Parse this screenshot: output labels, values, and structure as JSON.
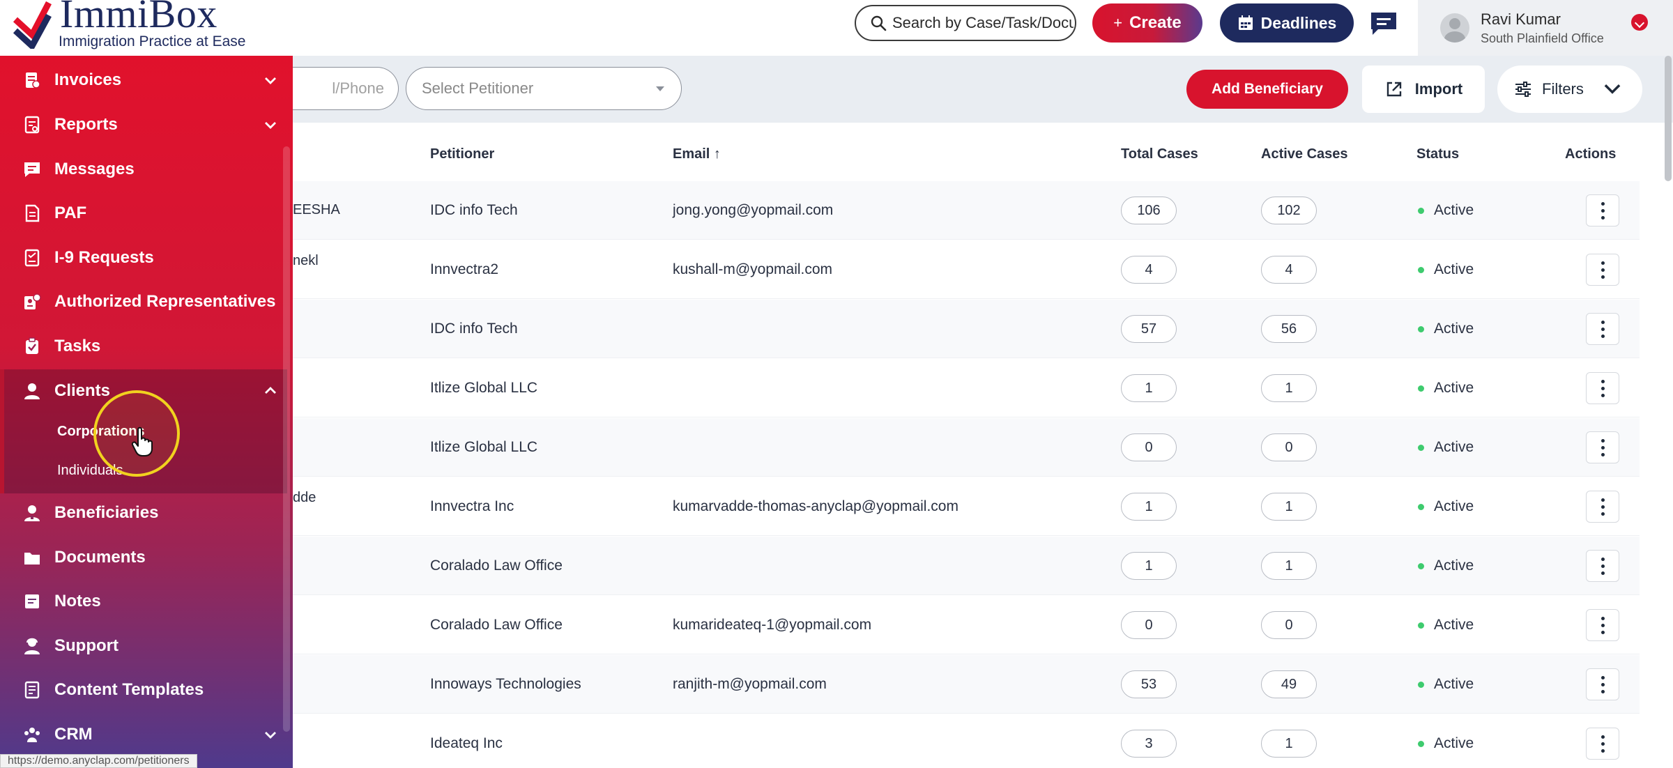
{
  "brand": {
    "name": "ImmiBox",
    "tagline": "Immigration Practice at Ease"
  },
  "header": {
    "search_placeholder": "Search by Case/Task/Docu",
    "create_label": "Create",
    "create_plus": "+",
    "deadlines_label": "Deadlines",
    "user": {
      "name": "Ravi Kumar",
      "office": "South Plainfield Office"
    }
  },
  "toolbar": {
    "search_placeholder": "l/Phone",
    "petitioner_select": "Select Petitioner",
    "add_beneficiary_label": "Add Beneficiary",
    "import_label": "Import",
    "filters_label": "Filters"
  },
  "sidebar": {
    "items": [
      {
        "label": "Invoices",
        "icon": "invoice-icon",
        "has_chevron": true
      },
      {
        "label": "Reports",
        "icon": "report-icon",
        "has_chevron": true
      },
      {
        "label": "Messages",
        "icon": "message-icon"
      },
      {
        "label": "PAF",
        "icon": "document-icon"
      },
      {
        "label": "I-9 Requests",
        "icon": "request-icon"
      },
      {
        "label": "Authorized Representatives",
        "icon": "representative-icon"
      },
      {
        "label": "Tasks",
        "icon": "task-icon"
      },
      {
        "label": "Clients",
        "icon": "client-icon",
        "expanded": true
      },
      {
        "label": "Beneficiaries",
        "icon": "beneficiary-icon"
      },
      {
        "label": "Documents",
        "icon": "folder-icon"
      },
      {
        "label": "Notes",
        "icon": "note-icon"
      },
      {
        "label": "Support",
        "icon": "support-icon"
      },
      {
        "label": "Content Templates",
        "icon": "template-icon"
      },
      {
        "label": "CRM",
        "icon": "crm-icon",
        "has_chevron": true
      }
    ],
    "clients_sub": [
      {
        "label": "Corporations",
        "active": true
      },
      {
        "label": "Individuals"
      }
    ]
  },
  "table": {
    "columns": {
      "petitioner": "Petitioner",
      "email": "Email",
      "email_sort": "↑",
      "total_cases": "Total Cases",
      "active_cases": "Active Cases",
      "status": "Status",
      "actions": "Actions"
    },
    "rows": [
      {
        "name_fragment": "EESHA",
        "petitioner": "IDC info Tech",
        "email": "jong.yong@yopmail.com",
        "total": "106",
        "active": "102",
        "status": "Active"
      },
      {
        "name_fragment": "nekl",
        "petitioner": "Innvectra2",
        "email": "kushall-m@yopmail.com",
        "total": "4",
        "active": "4",
        "status": "Active"
      },
      {
        "name_fragment": "",
        "petitioner": "IDC info Tech",
        "email": "",
        "total": "57",
        "active": "56",
        "status": "Active"
      },
      {
        "name_fragment": "",
        "petitioner": "Itlize Global LLC",
        "email": "",
        "total": "1",
        "active": "1",
        "status": "Active"
      },
      {
        "name_fragment": "",
        "petitioner": "Itlize Global LLC",
        "email": "",
        "total": "0",
        "active": "0",
        "status": "Active"
      },
      {
        "name_fragment": "dde",
        "petitioner": "Innvectra Inc",
        "email": "kumarvadde-thomas-anyclap@yopmail.com",
        "total": "1",
        "active": "1",
        "status": "Active"
      },
      {
        "name_fragment": "",
        "petitioner": "Coralado Law Office",
        "email": "",
        "total": "1",
        "active": "1",
        "status": "Active"
      },
      {
        "name_fragment": "",
        "petitioner": "Coralado Law Office",
        "email": "kumarideateq-1@yopmail.com",
        "total": "0",
        "active": "0",
        "status": "Active"
      },
      {
        "name_fragment": "",
        "petitioner": "Innoways Technologies",
        "email": "ranjith-m@yopmail.com",
        "total": "53",
        "active": "49",
        "status": "Active"
      },
      {
        "name_fragment": "",
        "petitioner": "Ideateq Inc",
        "email": "",
        "total": "3",
        "active": "1",
        "status": "Active"
      }
    ]
  },
  "status_bar_url": "https://demo.anyclap.com/petitioners",
  "colors": {
    "brand_red": "#d8132d",
    "brand_navy": "#1e2a5e",
    "active_green": "#3ecb6e"
  }
}
